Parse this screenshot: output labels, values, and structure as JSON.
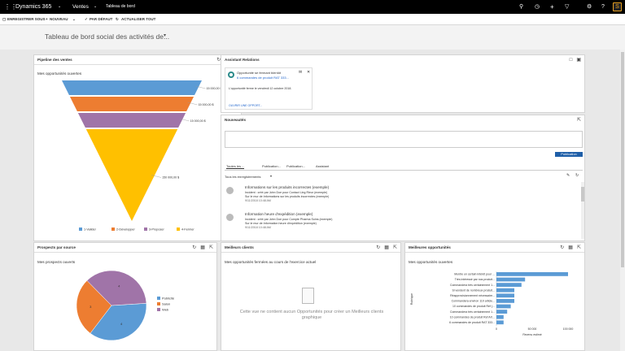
{
  "topbar": {
    "app_name": "Dynamics 365",
    "module": "Ventes",
    "page": "Tableau de bord"
  },
  "command_bar": {
    "save_as": "ENREGISTRER SOUS",
    "new": "NOUVEAU",
    "default": "PAR DÉFAUT",
    "refresh_all": "ACTUALISER TOUT"
  },
  "dashboard_title": "Tableau de bord social des activités de...",
  "pipeline": {
    "title": "Pipeline des ventes",
    "subtitle": "Mes opportunités ouvertes"
  },
  "relation_assistant": {
    "title": "Assistant Relations",
    "card_title": "Opportunité se fermant bientôt",
    "card_link": "6 commandes de produit RAT 333...",
    "card_text": "L'opportunité ferme le vendredi 12 octobre 2018.",
    "card_action": "OUVRIR UNE OPPORT..."
  },
  "news": {
    "title": "Nouveautés",
    "post_button": "Publication",
    "tabs": [
      "Toutes les ...",
      "Publication...",
      "Publication...",
      "Assistant"
    ],
    "filter": "Tous les enregistrements",
    "items": [
      {
        "title": "Informations sur les produits incorrectes (exemple)",
        "line1": "Incident : créé par John Doe pour Contact Ling Rieur (exemple)",
        "line2": "Sur le mur de Informations sur les produits incorrectes (exemple)",
        "time": "9/11/2018 10:48 AM"
      },
      {
        "title": "Information heure d'expédition (exemple)",
        "line1": "Incident : créé par John Doe pour Compte Pharma Soins (exemple)",
        "line2": "Sur le mur de Information heure d'expédition (exemple)",
        "time": "9/11/2018 10:48 AM"
      }
    ]
  },
  "prospects": {
    "title": "Prospects par source",
    "subtitle": "Mes prospects ouverts"
  },
  "best_clients": {
    "title": "Meilleurs clients",
    "subtitle": "Mes opportunités fermées au cours de l'exercice actuel",
    "empty_text": "Cette vue ne contient aucun Opportunités pour créer un Meilleurs clients graphique"
  },
  "best_opps": {
    "title": "Meilleures opportunités",
    "subtitle": "Mes opportunités ouvertes"
  },
  "chart_data": [
    {
      "type": "funnel",
      "categories": [
        "1-Valider",
        "2-Développer",
        "3-Proposer",
        "4-Fermer"
      ],
      "values": [
        15000,
        15000,
        15000,
        150000
      ],
      "value_labels": [
        "15 000,00 $",
        "15 000,00 $",
        "15 000,00 $",
        "150 000,00 $"
      ],
      "colors": [
        "#5b9bd5",
        "#ed7d31",
        "#a074a8",
        "#ffc000"
      ],
      "legend": "bottom"
    },
    {
      "type": "pie",
      "categories": [
        "Publicité",
        "Salon",
        "Web"
      ],
      "values": [
        4,
        3,
        4
      ],
      "colors": [
        "#5b9bd5",
        "#ed7d31",
        "#a074a8"
      ],
      "legend": "right"
    },
    {
      "type": "bar",
      "orientation": "horizontal",
      "categories": [
        "Montre un certain intérêt pour ...",
        "Très intéressé par nos produit...",
        "Commandera très certainement 1...",
        "Si vendent de nombreux produit...",
        "Réapprovisionnement nécessaire...",
        "Commandera environ 110 article...",
        "10 commandes de produit Ref (...",
        "Commandera très certainement 1...",
        "10 commandes de produit Ref AX...",
        "6 commandes de produit RAT 333..."
      ],
      "values": [
        100000,
        40000,
        35000,
        25000,
        25000,
        25000,
        20000,
        15000,
        10000,
        10000
      ],
      "xlabel": "Revenu estimé",
      "ylabel": "Rubrique",
      "x_ticks": [
        "0",
        "50 000",
        "100 000"
      ],
      "xlim": [
        0,
        100000
      ],
      "color": "#5b9bd5"
    }
  ]
}
